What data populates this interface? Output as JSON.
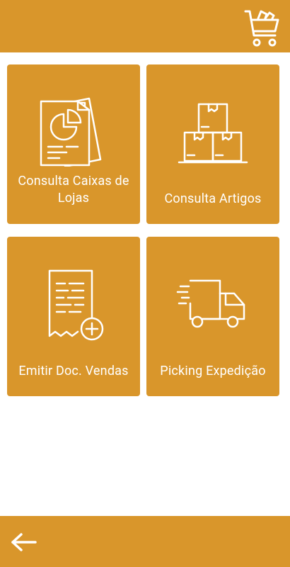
{
  "colors": {
    "accent": "#D9962B",
    "icon": "#ffffff",
    "background": "#ffffff"
  },
  "header": {
    "cart_icon": "cart-icon"
  },
  "tiles": [
    {
      "label": "Consulta Caixas de Lojas",
      "icon": "report-chart-icon"
    },
    {
      "label": "Consulta Artigos",
      "icon": "boxes-icon"
    },
    {
      "label": "Emitir Doc. Vendas",
      "icon": "receipt-add-icon"
    },
    {
      "label": "Picking Expedição",
      "icon": "delivery-truck-icon"
    }
  ],
  "footer": {
    "back_icon": "back-arrow-icon"
  }
}
